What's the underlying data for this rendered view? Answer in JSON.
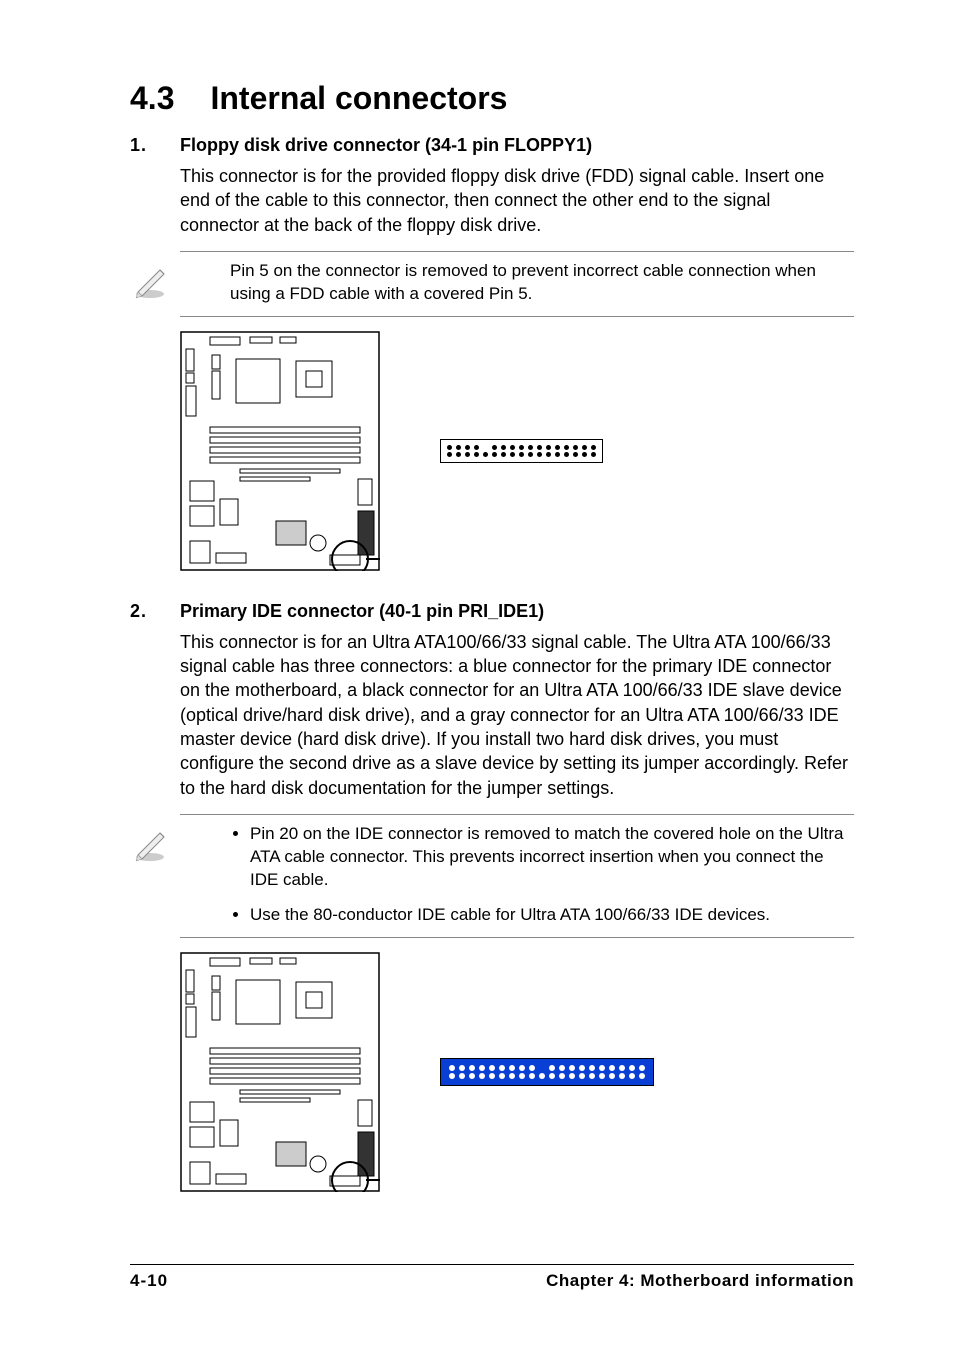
{
  "section": {
    "number": "4.3",
    "title": "Internal connectors"
  },
  "items": [
    {
      "num": "1.",
      "heading": "Floppy disk drive connector (34-1 pin FLOPPY1)",
      "body": "This connector is for the provided floppy disk drive (FDD) signal cable. Insert one end of the cable to this connector, then connect the other end to the signal connector at the back of the floppy disk drive.",
      "note_single": "Pin 5 on the connector is removed to prevent incorrect cable connection when using a FDD cable with a covered Pin 5."
    },
    {
      "num": "2.",
      "heading": "Primary IDE connector (40-1 pin PRI_IDE1)",
      "body": "This connector is for an Ultra ATA100/66/33 signal cable. The Ultra ATA 100/66/33 signal cable has three connectors: a blue connector for the primary IDE connector on the motherboard, a black connector for an Ultra ATA 100/66/33 IDE slave device (optical drive/hard disk drive), and a gray connector for an Ultra ATA 100/66/33 IDE master device (hard disk drive). If you install two hard disk drives, you must configure the second drive as a slave device by setting its jumper accordingly. Refer to the hard disk documentation for the jumper settings.",
      "note_bullets": [
        "Pin 20 on the IDE connector is removed to match the covered hole on the Ultra ATA cable connector. This prevents incorrect insertion when you connect the IDE cable.",
        "Use the 80-conductor IDE cable for Ultra ATA 100/66/33 IDE devices."
      ]
    }
  ],
  "footer": {
    "left": "4-10",
    "right": "Chapter 4:  Motherboard information"
  }
}
